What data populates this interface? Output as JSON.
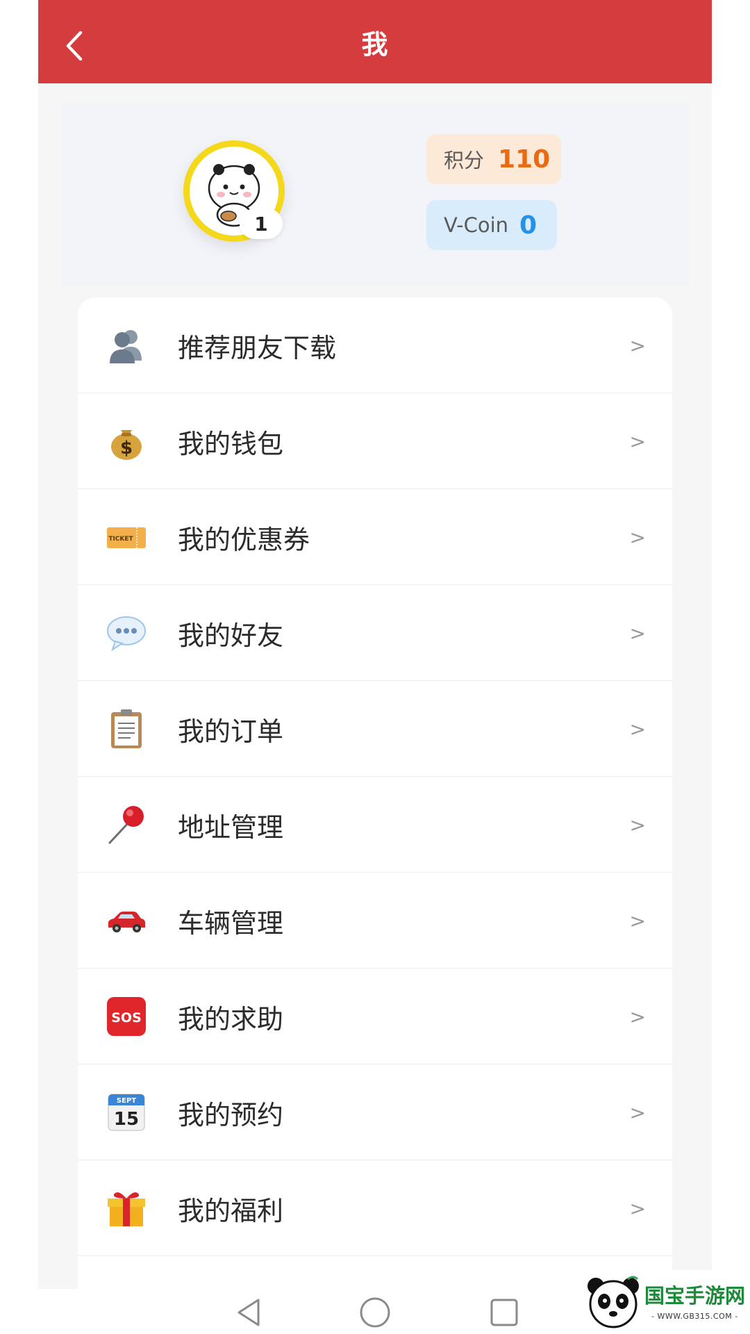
{
  "header": {
    "title": "我",
    "back_icon": "chevron-left-icon",
    "bg_color": "#d43c3d"
  },
  "profile": {
    "avatar_icon": "panda-avatar-icon",
    "level": "1",
    "points_label": "积分",
    "points_value": "110",
    "vcoin_label": "V-Coin",
    "vcoin_value": "0"
  },
  "menu": {
    "chevron": ">",
    "items": [
      {
        "label": "推荐朋友下载",
        "icon": "people-icon"
      },
      {
        "label": "我的钱包",
        "icon": "money-bag-icon"
      },
      {
        "label": "我的优惠券",
        "icon": "ticket-icon"
      },
      {
        "label": "我的好友",
        "icon": "speech-bubble-icon"
      },
      {
        "label": "我的订单",
        "icon": "clipboard-icon"
      },
      {
        "label": "地址管理",
        "icon": "pushpin-icon"
      },
      {
        "label": "车辆管理",
        "icon": "car-icon"
      },
      {
        "label": "我的求助",
        "icon": "sos-icon"
      },
      {
        "label": "我的预约",
        "icon": "calendar-icon"
      },
      {
        "label": "我的福利",
        "icon": "gift-icon"
      }
    ],
    "ticket_text": "TICKET",
    "calendar_month": "SEPT",
    "calendar_day": "15",
    "sos_text": "SOS"
  },
  "navbar": {
    "back": "nav-back-icon",
    "home": "nav-home-icon",
    "recents": "nav-recents-icon"
  },
  "watermark": {
    "name": "国宝手游网",
    "url": "- WWW.GB315.COM -"
  }
}
